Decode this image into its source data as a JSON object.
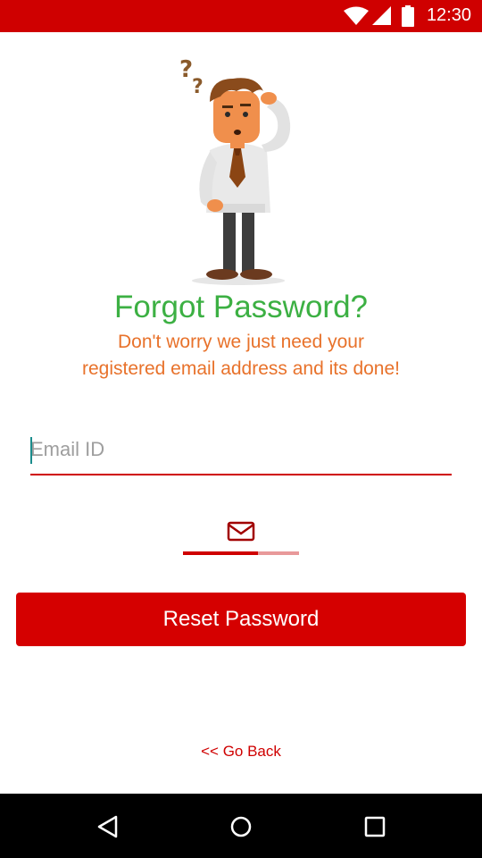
{
  "status_bar": {
    "time": "12:30",
    "icons": [
      "wifi-icon",
      "cell-signal-icon",
      "battery-icon"
    ],
    "color": "#cf0000"
  },
  "illustration": {
    "icon": "confused-man-illustration"
  },
  "title": "Forgot Password?",
  "message_line1": "Don't worry we just need your",
  "message_line2": "registered email address and its done!",
  "email": {
    "placeholder": "Email ID",
    "value": ""
  },
  "tab_indicator": {
    "icon": "mail-icon"
  },
  "reset_button": {
    "label": "Reset Password",
    "color": "#d50000"
  },
  "go_back": "<< Go Back",
  "nav_bar": {
    "buttons": [
      "back-triangle-icon",
      "home-circle-icon",
      "recents-square-icon"
    ]
  },
  "colors": {
    "title": "#3cb043",
    "message": "#e8722b",
    "accent": "#cf0000"
  }
}
